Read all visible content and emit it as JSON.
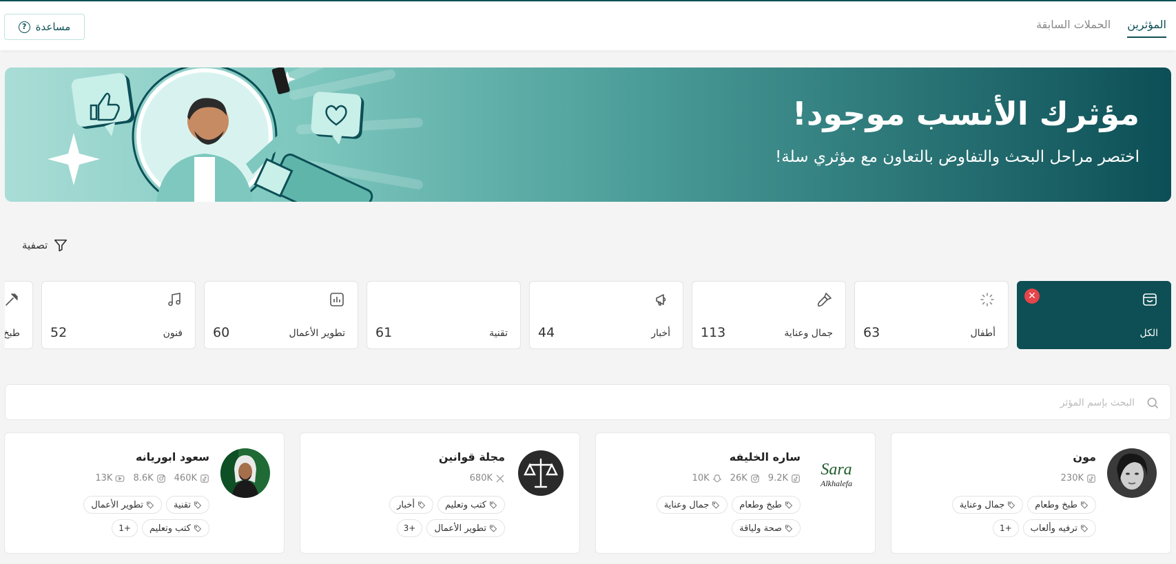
{
  "header": {
    "tabs": [
      {
        "label": "المؤثرين",
        "active": true
      },
      {
        "label": "الحملات السابقة",
        "active": false
      }
    ],
    "help_label": "مساعدة"
  },
  "banner": {
    "title": "مؤثرك الأنسب موجود!",
    "subtitle": "اختصر مراحل البحث والتفاوض بالتعاون مع مؤثري سلة!"
  },
  "filter": {
    "label": "تصفية"
  },
  "categories": [
    {
      "label": "الكل",
      "count": "",
      "icon": "store-icon",
      "active": true
    },
    {
      "label": "أطفال",
      "count": "63",
      "icon": "loader-icon",
      "active": false
    },
    {
      "label": "جمال وعناية",
      "count": "113",
      "icon": "brush-icon",
      "active": false
    },
    {
      "label": "أخبار",
      "count": "44",
      "icon": "megaphone-icon",
      "active": false
    },
    {
      "label": "تقنية",
      "count": "61",
      "icon": "",
      "active": false
    },
    {
      "label": "تطوير الأعمال",
      "count": "60",
      "icon": "bar-chart-icon",
      "active": false
    },
    {
      "label": "فنون",
      "count": "52",
      "icon": "music-icon",
      "active": false
    },
    {
      "label": "طبخ",
      "count": "",
      "icon": "utensils-icon",
      "active": false
    }
  ],
  "search": {
    "placeholder": "البحث بإسم المؤثر",
    "value": ""
  },
  "influencers": [
    {
      "name": "مون",
      "stats": [
        {
          "platform": "tiktok-icon",
          "value": "230K"
        }
      ],
      "tags": [
        "طبخ وطعام",
        "جمال وعناية",
        "ترفيه وألعاب"
      ],
      "more": "+1"
    },
    {
      "name": "ساره الخليفه",
      "avatar_text": [
        "Sara",
        "Alkhalefa"
      ],
      "stats": [
        {
          "platform": "tiktok-icon",
          "value": "9.2K"
        },
        {
          "platform": "instagram-icon",
          "value": "26K"
        },
        {
          "platform": "snapchat-icon",
          "value": "10K"
        }
      ],
      "tags": [
        "طبخ وطعام",
        "جمال وعناية",
        "صحة ولياقة"
      ],
      "more": ""
    },
    {
      "name": "مجلة قوانين",
      "stats": [
        {
          "platform": "x-icon",
          "value": "680K"
        }
      ],
      "tags": [
        "كتب وتعليم",
        "أخبار",
        "تطوير الأعمال"
      ],
      "more": "+3"
    },
    {
      "name": "سعود ابوريانه",
      "stats": [
        {
          "platform": "tiktok-icon",
          "value": "460K"
        },
        {
          "platform": "instagram-icon",
          "value": "8.6K"
        },
        {
          "platform": "youtube-icon",
          "value": "13K"
        }
      ],
      "tags": [
        "تقنية",
        "تطوير الأعمال",
        "كتب وتعليم"
      ],
      "more": "+1"
    }
  ],
  "colors": {
    "brand": "#0d4f54",
    "accent": "#7ec8bf",
    "danger": "#e6444a"
  }
}
